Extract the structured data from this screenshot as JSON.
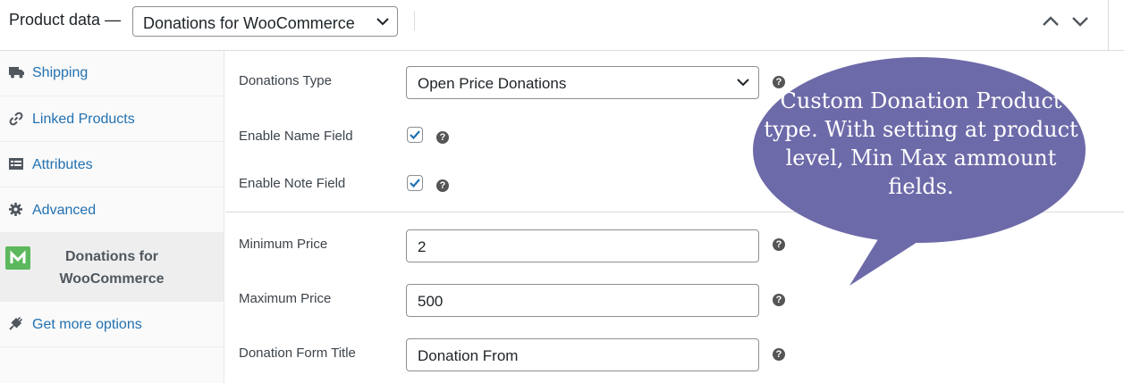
{
  "header": {
    "title": "Product data —",
    "product_type": "Donations for WooCommerce"
  },
  "sidebar": {
    "items": [
      {
        "label": "Shipping",
        "icon": "truck-icon"
      },
      {
        "label": "Linked Products",
        "icon": "link-icon"
      },
      {
        "label": "Attributes",
        "icon": "list-icon"
      },
      {
        "label": "Advanced",
        "icon": "gear-icon"
      },
      {
        "label": "Donations for WooCommerce",
        "icon": "plugin-logo",
        "active": true
      },
      {
        "label": "Get more options",
        "icon": "plug-icon"
      }
    ]
  },
  "fields": {
    "donations_type": {
      "label": "Donations Type",
      "value": "Open Price Donations"
    },
    "enable_name": {
      "label": "Enable Name Field",
      "checked": true
    },
    "enable_note": {
      "label": "Enable Note Field",
      "checked": true
    },
    "min_price": {
      "label": "Minimum Price",
      "value": "2"
    },
    "max_price": {
      "label": "Maximum Price",
      "value": "500"
    },
    "form_title": {
      "label": "Donation Form Title",
      "value": "Donation From"
    }
  },
  "help_glyph": "?",
  "callout": {
    "text": "Custom Donation Product type. With setting at product level, Min Max ammount fields."
  },
  "colors": {
    "link": "#2271b1",
    "bubble": "#6d6aa9",
    "checkmark": "#2271b1"
  }
}
